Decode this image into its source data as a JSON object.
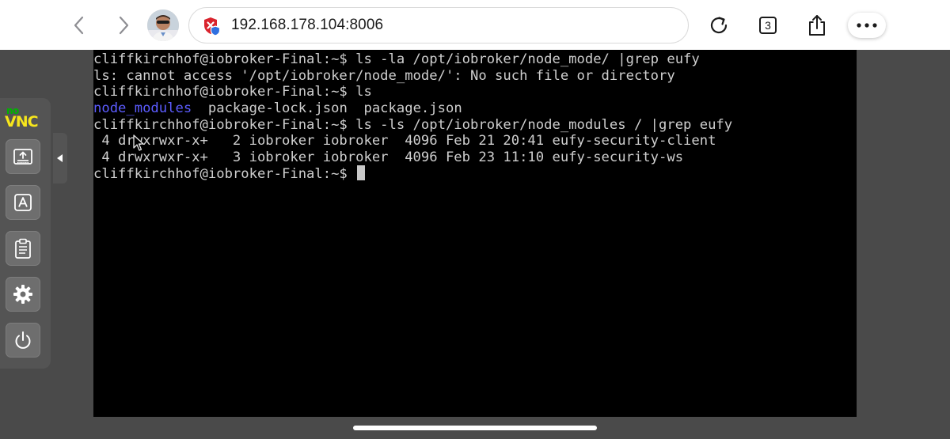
{
  "browser": {
    "url": "192.168.178.104:8006",
    "tab_count": "3",
    "icons": {
      "back": "chevron-left-icon",
      "forward": "chevron-right-icon",
      "security": "shield-icon",
      "reload": "reload-icon",
      "tabs": "tabs-icon",
      "share": "share-icon",
      "more": "ellipsis-icon"
    }
  },
  "terminal": {
    "lines": [
      "cliffkirchhof@iobroker-Final:~$ ls -la /opt/iobroker/node_mode/ |grep eufy",
      "ls: cannot access '/opt/iobroker/node_mode/': No such file or directory",
      "cliffkirchhof@iobroker-Final:~$ ls",
      "node_modules",
      "  package-lock.json  package.json",
      "cliffkirchhof@iobroker-Final:~$ ls -ls /opt/iobroker/node_modules / |grep eufy",
      " 4 drwxrwxr-x+   2 iobroker iobroker  4096 Feb 21 20:41 eufy-security-client",
      " 4 drwxrwxr-x+   3 iobroker iobroker  4096 Feb 23 11:10 eufy-security-ws",
      "cliffkirchhof@iobroker-Final:~$ "
    ]
  },
  "novnc": {
    "logo_no": "no",
    "logo_vnc": "VNC",
    "buttons": [
      "keyboard-icon",
      "extra-keys-icon",
      "clipboard-icon",
      "settings-icon",
      "power-icon"
    ],
    "handle_icon": "caret-left-icon"
  },
  "colors": {
    "terminal_bg": "#000000",
    "terminal_fg": "#cfcfcf",
    "directory": "#5c5cff",
    "novnc_panel": "#545454",
    "novnc_logo_green": "#00b300",
    "novnc_logo_yellow": "#f6e51c",
    "shield_red": "#d9232d",
    "shield_blue": "#2f6fe0"
  }
}
